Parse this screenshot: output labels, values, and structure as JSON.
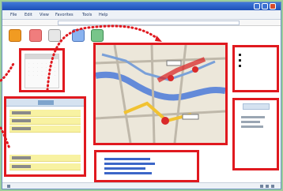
{
  "window": {
    "title": "",
    "address": ""
  },
  "menus": {
    "items": [
      {
        "label": "File"
      },
      {
        "label": "Edit"
      },
      {
        "label": "View"
      },
      {
        "label": "Favorites"
      },
      {
        "label": "Tools"
      },
      {
        "label": "Help"
      }
    ]
  },
  "toolbar": {
    "icons": [
      "home-icon",
      "heart-icon",
      "phone-icon",
      "globe-icon",
      "settings-icon"
    ]
  },
  "colors": {
    "highlight_red": "#e0191f",
    "map_road_blue": "#4b79d8",
    "map_route_red": "#d9292a",
    "panel_yellow": "#f8f2a2",
    "background_green": "#9ccf9c"
  }
}
